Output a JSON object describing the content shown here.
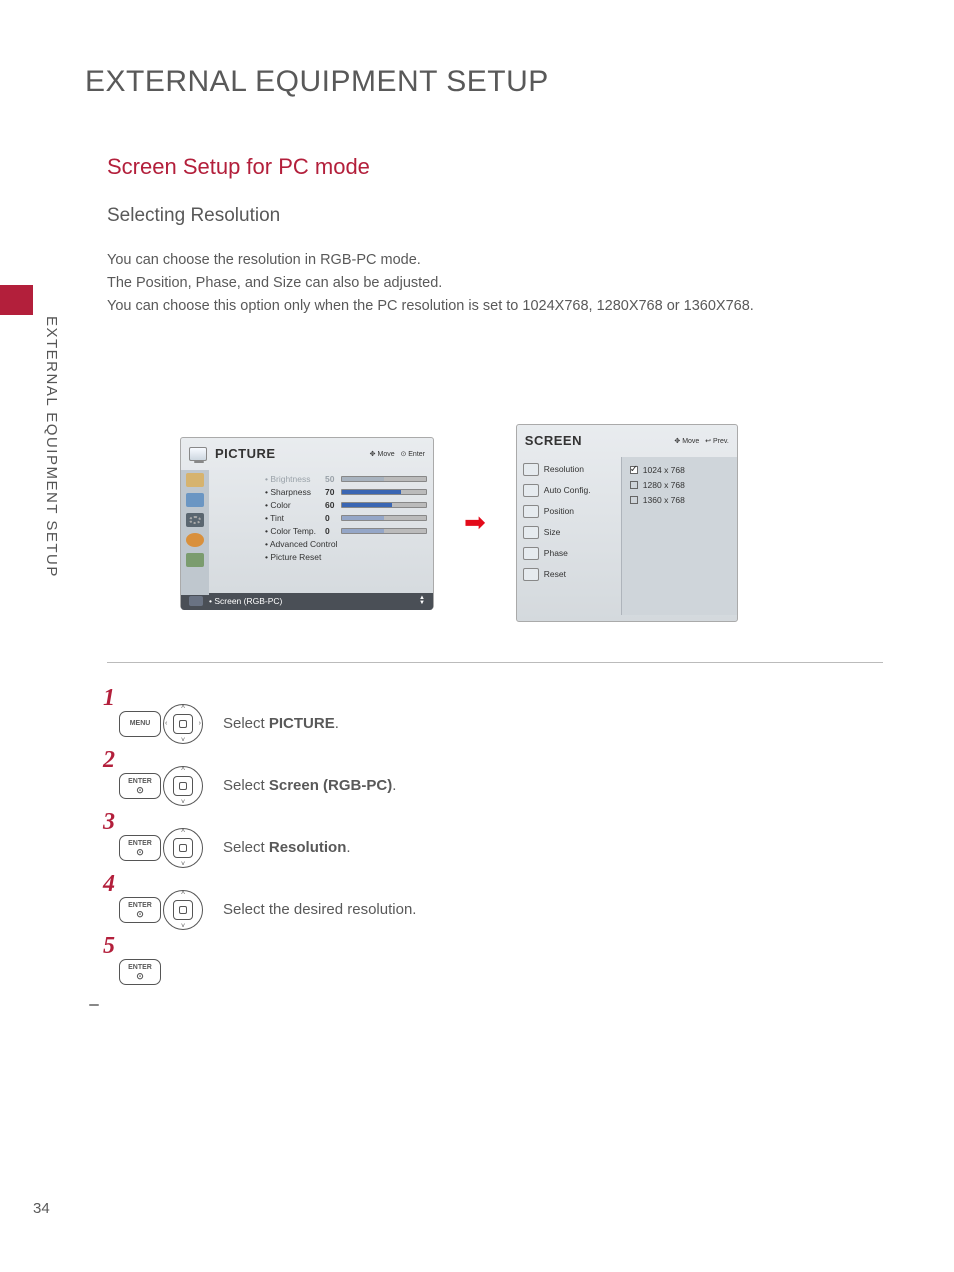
{
  "side_tab": "EXTERNAL EQUIPMENT SETUP",
  "page_title": "EXTERNAL EQUIPMENT SETUP",
  "sub_title": "Screen Setup for PC mode",
  "section_title": "Selecting Resolution",
  "body": {
    "line1": "You can choose the resolution in RGB-PC mode.",
    "line2": "The Position, Phase, and Size can also be adjusted.",
    "line3": "You can choose this option only when the PC resolution is set to 1024X768, 1280X768 or 1360X768."
  },
  "osd_picture": {
    "title": "PICTURE",
    "hint_move": "Move",
    "hint_enter": "Enter",
    "settings": [
      {
        "label": "• Brightness",
        "value": "50",
        "fill": 50,
        "dim": true,
        "type": "bar"
      },
      {
        "label": "• Sharpness",
        "value": "70",
        "fill": 70,
        "dim": false,
        "type": "bar"
      },
      {
        "label": "• Color",
        "value": "60",
        "fill": 60,
        "dim": false,
        "type": "bar"
      },
      {
        "label": "• Tint",
        "value": "0",
        "fill": 50,
        "dim": false,
        "type": "center"
      },
      {
        "label": "• Color Temp.",
        "value": "0",
        "fill": 50,
        "dim": false,
        "type": "center"
      },
      {
        "label": "• Advanced Control",
        "value": "",
        "type": "none"
      },
      {
        "label": "• Picture Reset",
        "value": "",
        "type": "none"
      }
    ],
    "footer": "• Screen (RGB-PC)"
  },
  "osd_screen": {
    "title": "SCREEN",
    "hint_move": "Move",
    "hint_prev": "Prev.",
    "menu": [
      "Resolution",
      "Auto Config.",
      "Position",
      "Size",
      "Phase",
      "Reset"
    ],
    "resolutions": [
      {
        "label": "1024 x 768",
        "checked": true
      },
      {
        "label": "1280 x 768",
        "checked": false
      },
      {
        "label": "1360 x 768",
        "checked": false
      }
    ]
  },
  "steps": {
    "s1": {
      "btn": "MENU",
      "text_pre": "Select ",
      "bold": "PICTURE",
      "text_post": "."
    },
    "s2": {
      "btn": "ENTER",
      "text_pre": "Select ",
      "bold": "Screen (RGB-PC)",
      "text_post": "."
    },
    "s3": {
      "btn": "ENTER",
      "text_pre": "Select ",
      "bold": "Resolution",
      "text_post": "."
    },
    "s4": {
      "btn": "ENTER",
      "text": "Select the desired resolution."
    },
    "s5": {
      "btn": "ENTER"
    }
  },
  "page_number": "34"
}
